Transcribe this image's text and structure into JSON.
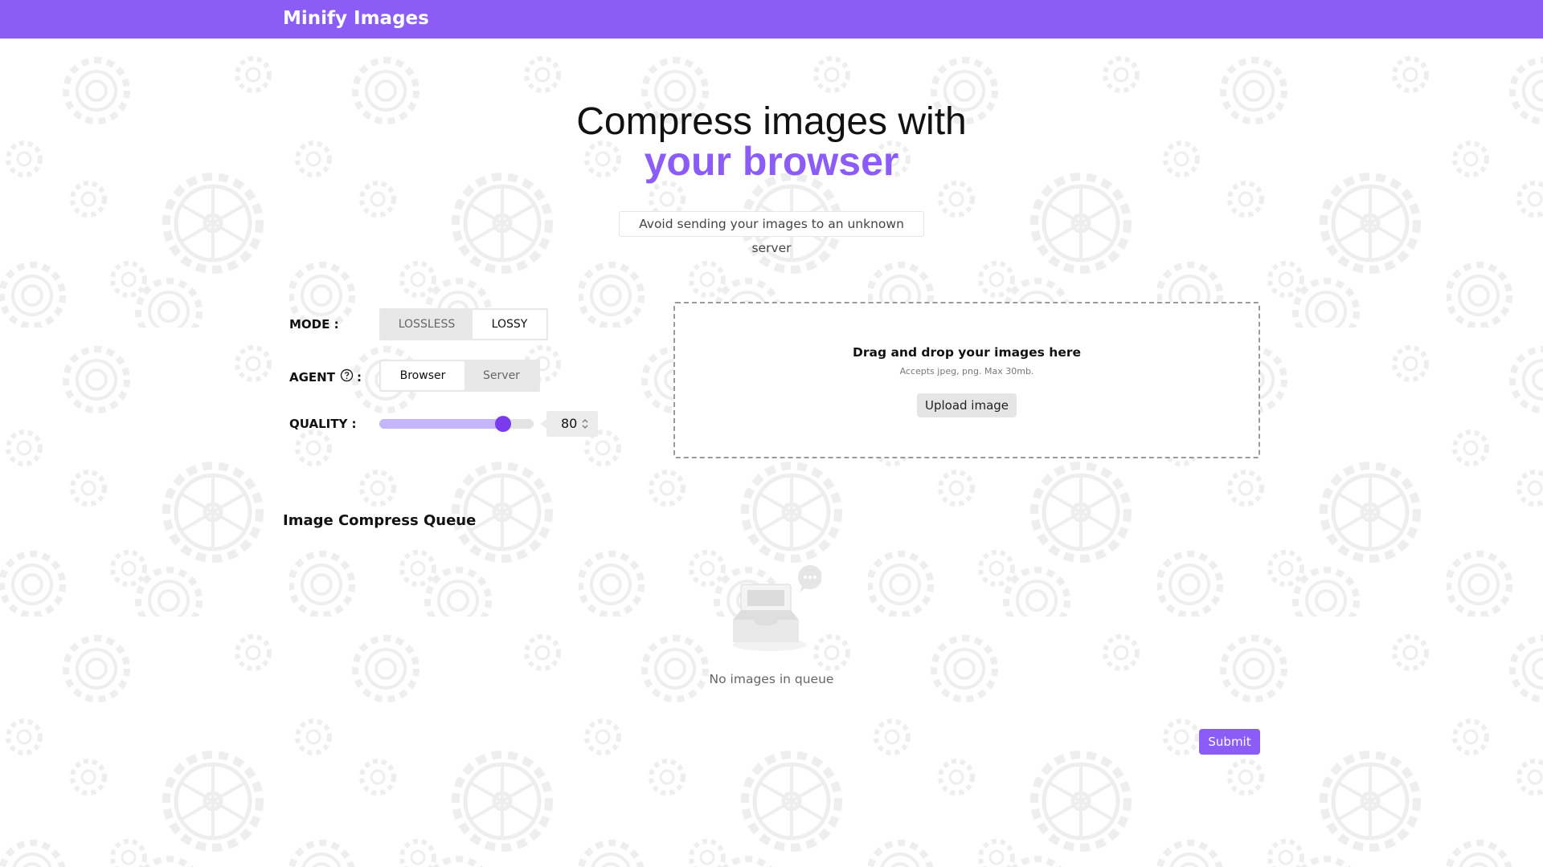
{
  "header": {
    "brand": "Minify Images"
  },
  "hero": {
    "line1": "Compress images with",
    "line2": "your browser",
    "tagline": "Avoid sending your images to an unknown server"
  },
  "controls": {
    "mode": {
      "label": "MODE :",
      "options": [
        "LOSSLESS",
        "LOSSY"
      ],
      "selected": "LOSSY"
    },
    "agent": {
      "label": "AGENT",
      "colon": ":",
      "help_icon": "question-circle-icon",
      "options": [
        "Browser",
        "Server"
      ],
      "selected": "Browser"
    },
    "quality": {
      "label": "QUALITY :",
      "value": "80",
      "slider_fraction": 0.8
    }
  },
  "dropzone": {
    "title": "Drag and drop your images here",
    "subtitle": "Accepts jpeg, png. Max 30mb.",
    "button": "Upload image"
  },
  "queue": {
    "title": "Image Compress Queue",
    "empty_icon": "empty-inbox-icon",
    "empty_text": "No images in queue"
  },
  "actions": {
    "submit": "Submit"
  },
  "colors": {
    "accent": "#8b5cf6",
    "accent_dark": "#7c3aed",
    "accent_light": "#c4b5fd"
  }
}
